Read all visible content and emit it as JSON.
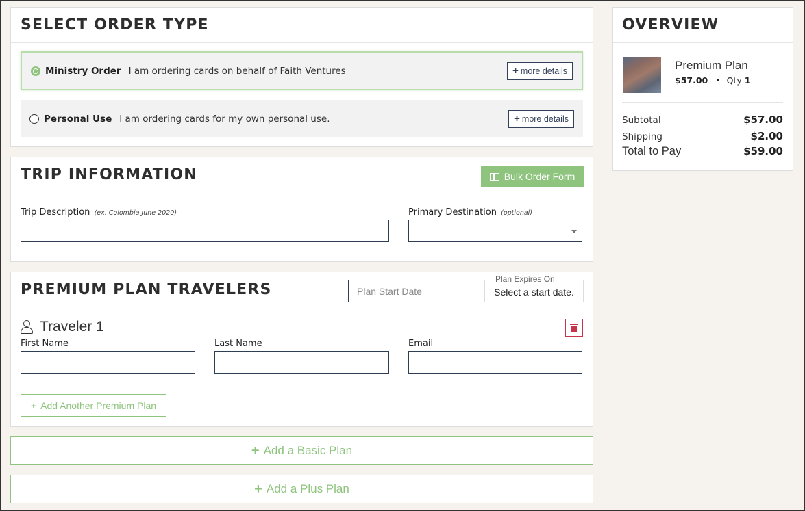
{
  "order_type": {
    "title": "SELECT ORDER TYPE",
    "options": [
      {
        "name": "Ministry Order",
        "description": "I am ordering cards on behalf of Faith Ventures",
        "selected": true,
        "details_label": "more details"
      },
      {
        "name": "Personal Use",
        "description": "I am ordering cards for my own personal use.",
        "selected": false,
        "details_label": "more details"
      }
    ]
  },
  "trip": {
    "title": "TRIP INFORMATION",
    "bulk_label": "Bulk Order Form",
    "description_label": "Trip Description",
    "description_hint": "(ex. Colombia June 2020)",
    "description_value": "",
    "destination_label": "Primary Destination",
    "destination_hint": "(optional)",
    "destination_value": ""
  },
  "travelers": {
    "title": "PREMIUM PLAN TRAVELERS",
    "start_placeholder": "Plan Start Date",
    "expires_legend": "Plan Expires On",
    "expires_value": "Select a start date.",
    "traveler_title": "Traveler 1",
    "first_name_label": "First Name",
    "last_name_label": "Last Name",
    "email_label": "Email",
    "add_another_label": "Add Another Premium Plan"
  },
  "add_basic_label": "Add a Basic Plan",
  "add_plus_label": "Add a Plus Plan",
  "overview": {
    "title": "OVERVIEW",
    "item_name": "Premium Plan",
    "item_price": "$57.00",
    "qty_label": "Qty",
    "qty": "1",
    "subtotal_label": "Subtotal",
    "subtotal": "$57.00",
    "shipping_label": "Shipping",
    "shipping": "$2.00",
    "total_label": "Total to Pay",
    "total": "$59.00"
  },
  "colors": {
    "accent_green": "#8ec47e",
    "navy": "#2f3e55",
    "danger": "#c4344b",
    "background": "#f6f3ee"
  }
}
